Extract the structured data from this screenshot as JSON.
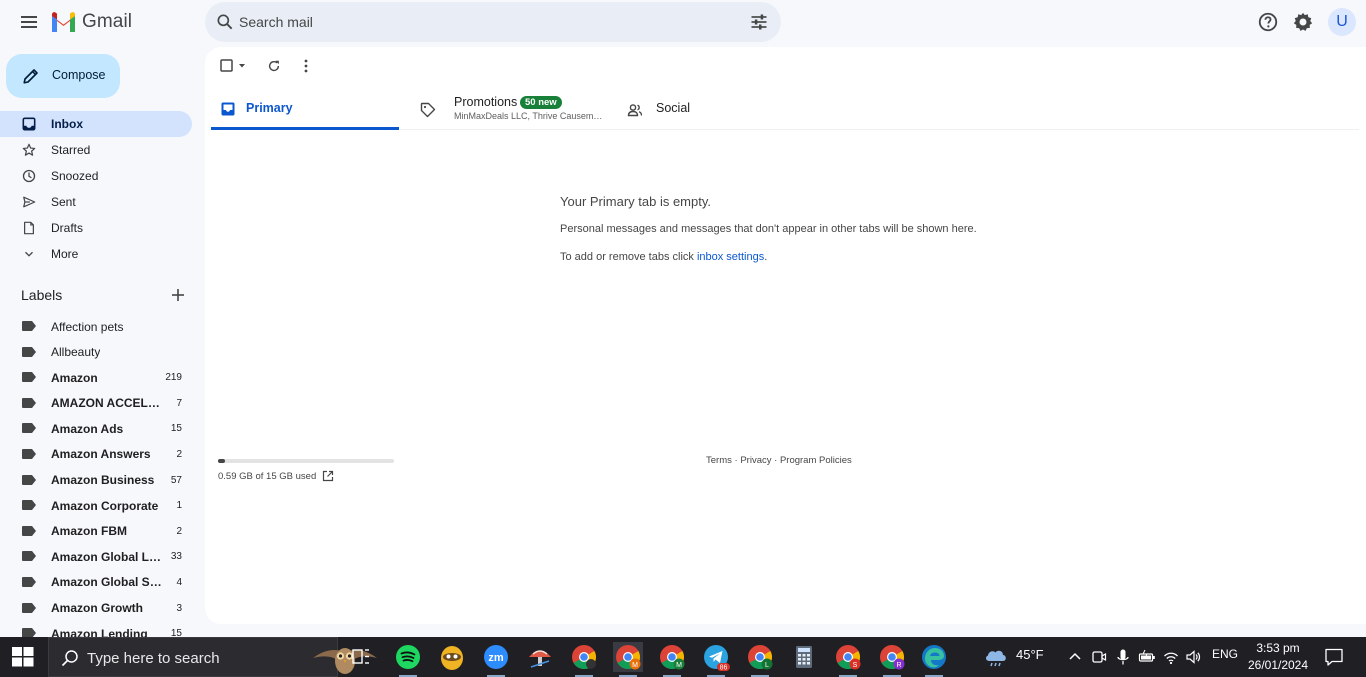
{
  "app": {
    "name": "Gmail"
  },
  "colors": {
    "accent": "#0b57d0",
    "compose_bg": "#c2e7ff",
    "active_nav": "#d3e3fd",
    "badge_green": "#188038",
    "gmail_red": "#ea4335",
    "gmail_blue": "#4285f4",
    "gmail_green": "#34a853",
    "gmail_yellow": "#fbbc04"
  },
  "search": {
    "placeholder": "Search mail"
  },
  "header": {
    "avatar_letter": "U"
  },
  "compose": {
    "label": "Compose"
  },
  "nav": [
    {
      "label": "Inbox",
      "icon": "inbox-icon"
    },
    {
      "label": "Starred",
      "icon": "star-icon"
    },
    {
      "label": "Snoozed",
      "icon": "clock-icon"
    },
    {
      "label": "Sent",
      "icon": "send-icon"
    },
    {
      "label": "Drafts",
      "icon": "draft-icon"
    },
    {
      "label": "More",
      "icon": "chevron-down-icon"
    }
  ],
  "labels_header": "Labels",
  "labels": [
    {
      "name": "Affection pets",
      "count": ""
    },
    {
      "name": "Allbeauty",
      "count": ""
    },
    {
      "name": "Amazon",
      "count": "219"
    },
    {
      "name": "AMAZON ACCELERATOR",
      "count": "7"
    },
    {
      "name": "Amazon Ads",
      "count": "15"
    },
    {
      "name": "Amazon Answers",
      "count": "2"
    },
    {
      "name": "Amazon Business",
      "count": "57"
    },
    {
      "name": "Amazon Corporate",
      "count": "1"
    },
    {
      "name": "Amazon FBM",
      "count": "2"
    },
    {
      "name": "Amazon Global Logistics",
      "count": "33"
    },
    {
      "name": "Amazon Global Selling",
      "count": "4"
    },
    {
      "name": "Amazon Growth",
      "count": "3"
    },
    {
      "name": "Amazon Lending",
      "count": "15"
    }
  ],
  "tabs": {
    "primary": "Primary",
    "promotions": "Promotions",
    "promotions_badge": "50 new",
    "promotions_senders": "MinMaxDeals LLC, Thrive Causemetics",
    "social": "Social"
  },
  "empty_state": {
    "title": "Your Primary tab is empty.",
    "description": "Personal messages and messages that don't appear in other tabs will be shown here.",
    "settings_prefix": "To add or remove tabs click ",
    "settings_link": "inbox settings",
    "settings_suffix": "."
  },
  "storage": {
    "text": "0.59 GB of 15 GB used",
    "used_fraction": 0.039
  },
  "footer": {
    "terms": "Terms",
    "privacy": "Privacy",
    "policies": "Program Policies",
    "sep": " · "
  },
  "taskbar": {
    "search_placeholder": "Type here to search",
    "weather": "45°F",
    "language": "ENG",
    "time": "3:53 pm",
    "date": "26/01/2024",
    "badges": {
      "telegram": "86",
      "chrome_m": "M",
      "chrome_m2": "M",
      "chrome_l": "L",
      "chrome_s": "S",
      "chrome_r": "R"
    }
  }
}
